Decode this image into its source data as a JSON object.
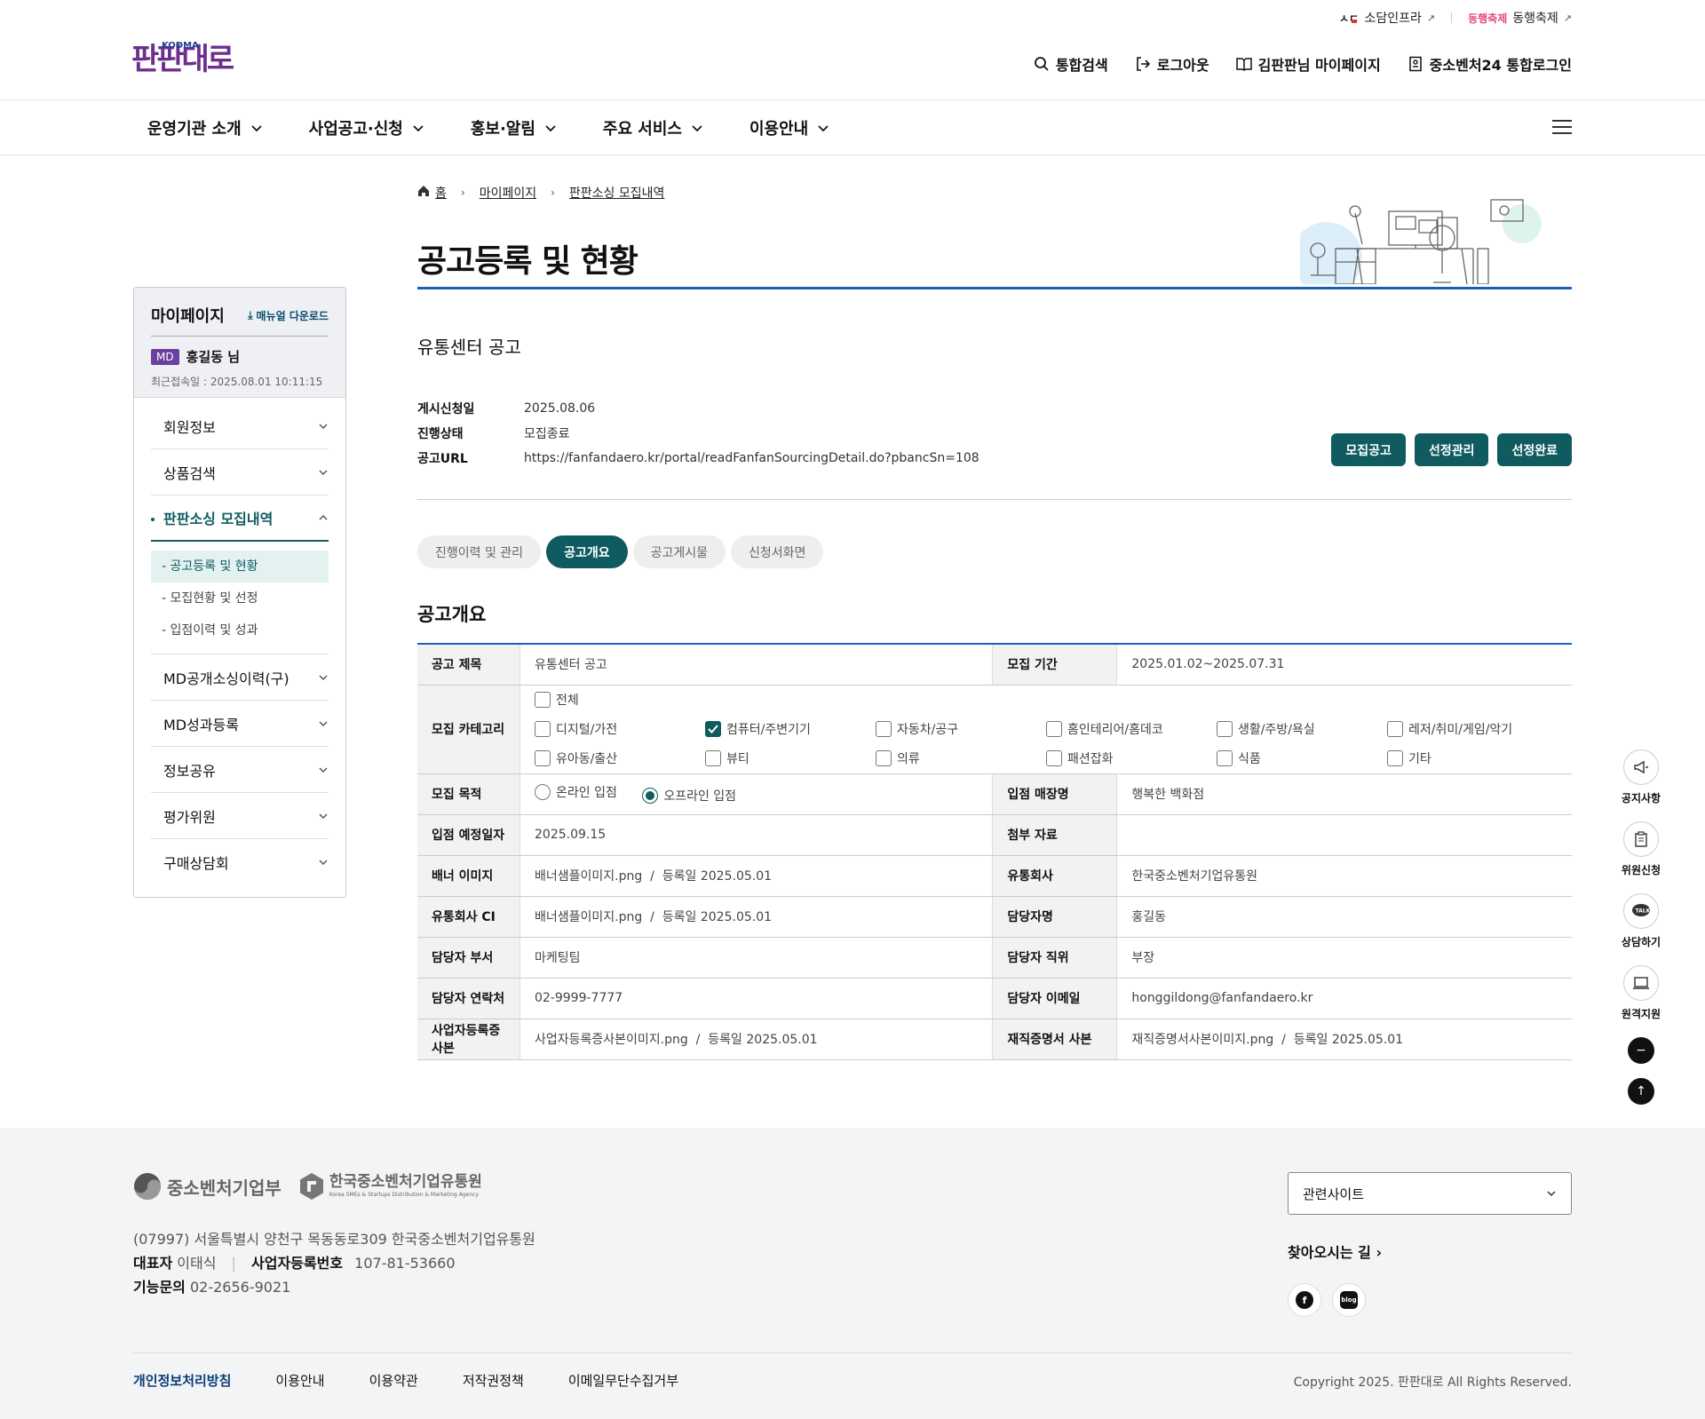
{
  "topbar": {
    "sodam": "소담인프라",
    "donghaeng_logo": "동행축제",
    "donghaeng": "동행축제"
  },
  "logo": {
    "brand": "판판대로",
    "kodma": "KODMA"
  },
  "util": {
    "search": "통합검색",
    "logout": "로그아웃",
    "mypage": "김판판님 마이페이지",
    "login24": "중소벤처24 통합로그인"
  },
  "gnb": [
    "운영기관 소개",
    "사업공고·신청",
    "홍보·알림",
    "주요 서비스",
    "이용안내"
  ],
  "lnb": {
    "title": "마이페이지",
    "manual": "매뉴얼 다운로드",
    "badge": "MD",
    "user": "홍길동 님",
    "last_login": "최근접속일 : 2025.08.01 10:11:15",
    "items": [
      "회원정보",
      "상품검색",
      "판판소싱 모집내역",
      "MD공개소싱이력(구)",
      "MD성과등록",
      "정보공유",
      "평가위원",
      "구매상담회"
    ],
    "sub": [
      "- 공고등록 및 현황",
      "- 모집현황 및 선정",
      "- 입점이력 및 성과"
    ]
  },
  "breadcrumb": {
    "home": "홈",
    "mypage": "마이페이지",
    "current": "판판소싱 모집내역"
  },
  "page_title": "공고등록 및 현황",
  "notice": {
    "name": "유통센터 공고",
    "k1": "게시신청일",
    "v1": "2025.08.06",
    "k2": "진행상태",
    "v2": "모집종료",
    "k3": "공고URL",
    "v3": "https://fanfandaero.kr/portal/readFanfanSourcingDetail.do?pbancSn=108"
  },
  "buttons": {
    "b1": "모집공고",
    "b2": "선정관리",
    "b3": "선정완료"
  },
  "tabs": [
    "진행이력 및 관리",
    "공고개요",
    "공고게시물",
    "신청서화면"
  ],
  "section_title": "공고개요",
  "table": {
    "title_k": "공고 제목",
    "title_v": "유통센터 공고",
    "period_k": "모집 기간",
    "period_v": "2025.01.02~2025.07.31",
    "cat_k": "모집 카테고리",
    "cat_all": "전체",
    "cats": [
      "디지털/가전",
      "컴퓨터/주변기기",
      "자동차/공구",
      "홈인테리어/홈데코",
      "생활/주방/욕실",
      "레저/취미/게임/악기",
      "유아동/출산",
      "뷰티",
      "의류",
      "패션잡화",
      "식품",
      "기타"
    ],
    "purpose_k": "모집 목적",
    "online": "온라인 입점",
    "offline": "오프라인 입점",
    "store_k": "입점 매장명",
    "store_v": "행복한 백화점",
    "date_k": "입점 예정일자",
    "date_v": "2025.09.15",
    "attach_k": "첨부 자료",
    "attach_v": "",
    "banner_k": "배너 이미지",
    "banner_v": "배너샘플이미지.png  /  등록일 2025.05.01",
    "dist_k": "유통회사",
    "dist_v": "한국중소벤처기업유통원",
    "ci_k": "유통회사 CI",
    "ci_v": "배너샘플이미지.png  /  등록일 2025.05.01",
    "mgr_k": "담당자명",
    "mgr_v": "홍길동",
    "dept_k": "담당자 부서",
    "dept_v": "마케팅팀",
    "pos_k": "담당자 직위",
    "pos_v": "부장",
    "tel_k": "담당자 연락처",
    "tel_v": "02-9999-7777",
    "mail_k": "담당자 이메일",
    "mail_v": "honggildong@fanfandaero.kr",
    "biz_k": "사업자등록증 사본",
    "biz_v": "사업자등록증사본이미지.png  /  등록일 2025.05.01",
    "emp_k": "재직증명서 사본",
    "emp_v": "재직증명서사본이미지.png  /  등록일 2025.05.01"
  },
  "quick": [
    "공지사항",
    "위원신청",
    "상담하기",
    "원격지원"
  ],
  "footer": {
    "mss": "중소벤처기업부",
    "kodma": "한국중소벤처기업유통원",
    "kodma_en": "Korea SMEs & Startups Distribution & Marketing Agency",
    "addr": "(07997) 서울특별시 양천구 목동동로309 한국중소벤처기업유통원",
    "ceo_k": "대표자",
    "ceo_v": "이태식",
    "biz_k": "사업자등록번호",
    "biz_v": "107-81-53660",
    "tel_k": "기능문의",
    "tel_v": "02-2656-9021",
    "related": "관련사이트",
    "way": "찾아오시는 길",
    "links": [
      "개인정보처리방침",
      "이용안내",
      "이용약관",
      "저작권정책",
      "이메일무단수집거부"
    ],
    "copyright": "Copyright 2025. 판판대로 All Rights Reserved."
  }
}
